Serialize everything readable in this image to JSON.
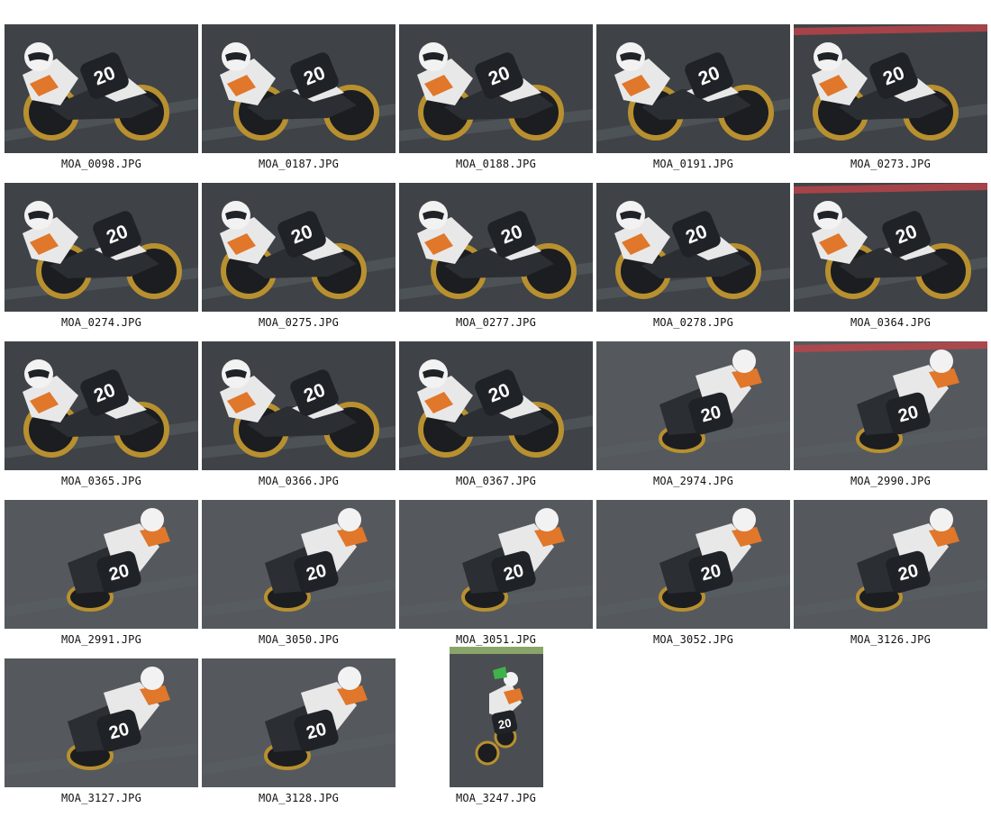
{
  "gallery": {
    "items": [
      {
        "filename": "MOA_0098.JPG",
        "number": "20"
      },
      {
        "filename": "MOA_0187.JPG",
        "number": "20"
      },
      {
        "filename": "MOA_0188.JPG",
        "number": "20"
      },
      {
        "filename": "MOA_0191.JPG",
        "number": "20"
      },
      {
        "filename": "MOA_0273.JPG",
        "number": "20"
      },
      {
        "filename": "MOA_0274.JPG",
        "number": "20"
      },
      {
        "filename": "MOA_0275.JPG",
        "number": "20"
      },
      {
        "filename": "MOA_0277.JPG",
        "number": "20"
      },
      {
        "filename": "MOA_0278.JPG",
        "number": "20"
      },
      {
        "filename": "MOA_0364.JPG",
        "number": "20"
      },
      {
        "filename": "MOA_0365.JPG",
        "number": "20"
      },
      {
        "filename": "MOA_0366.JPG",
        "number": "20"
      },
      {
        "filename": "MOA_0367.JPG",
        "number": "20"
      },
      {
        "filename": "MOA_2974.JPG",
        "number": "20"
      },
      {
        "filename": "MOA_2990.JPG",
        "number": "20"
      },
      {
        "filename": "MOA_2991.JPG",
        "number": "20"
      },
      {
        "filename": "MOA_3050.JPG",
        "number": "20"
      },
      {
        "filename": "MOA_3051.JPG",
        "number": "20"
      },
      {
        "filename": "MOA_3052.JPG",
        "number": "20"
      },
      {
        "filename": "MOA_3126.JPG",
        "number": "20"
      },
      {
        "filename": "MOA_3127.JPG",
        "number": "20"
      },
      {
        "filename": "MOA_3128.JPG",
        "number": "20"
      },
      {
        "filename": "MOA_3247.JPG",
        "number": "20"
      }
    ]
  },
  "colors": {
    "background": "#ffffff",
    "caption_text": "#111111",
    "track_asphalt": "#3f4347",
    "track_asphalt_light": "#5a5e62",
    "rider_suit_white": "#e8e8e8",
    "rider_suit_orange": "#e0772a",
    "number_plate": "#1f2226",
    "number_text": "#ffffff",
    "wheel_gold": "#b8902f",
    "curb_red": "#c8434a"
  },
  "icons": {
    "thumbnail": "motorcycle-photo-thumbnail"
  }
}
